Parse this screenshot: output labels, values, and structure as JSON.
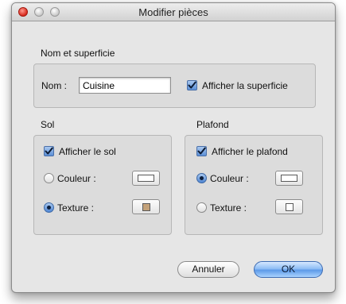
{
  "window": {
    "title": "Modifier pièces"
  },
  "name_group": {
    "label": "Nom et superficie",
    "name_label": "Nom :",
    "name_value": "Cuisine",
    "show_area_label": "Afficher la superficie",
    "show_area_checked": true
  },
  "floor": {
    "label": "Sol",
    "show_label": "Afficher le sol",
    "show_checked": true,
    "color_label": "Couleur :",
    "texture_label": "Texture :",
    "selected": "texture"
  },
  "ceiling": {
    "label": "Plafond",
    "show_label": "Afficher le plafond",
    "show_checked": true,
    "color_label": "Couleur :",
    "texture_label": "Texture :",
    "selected": "color"
  },
  "buttons": {
    "cancel_label": "Annuler",
    "ok_label": "OK"
  },
  "colors": {
    "texture_swatch": "#c4a27a",
    "default_swatch": "#ffffff"
  }
}
